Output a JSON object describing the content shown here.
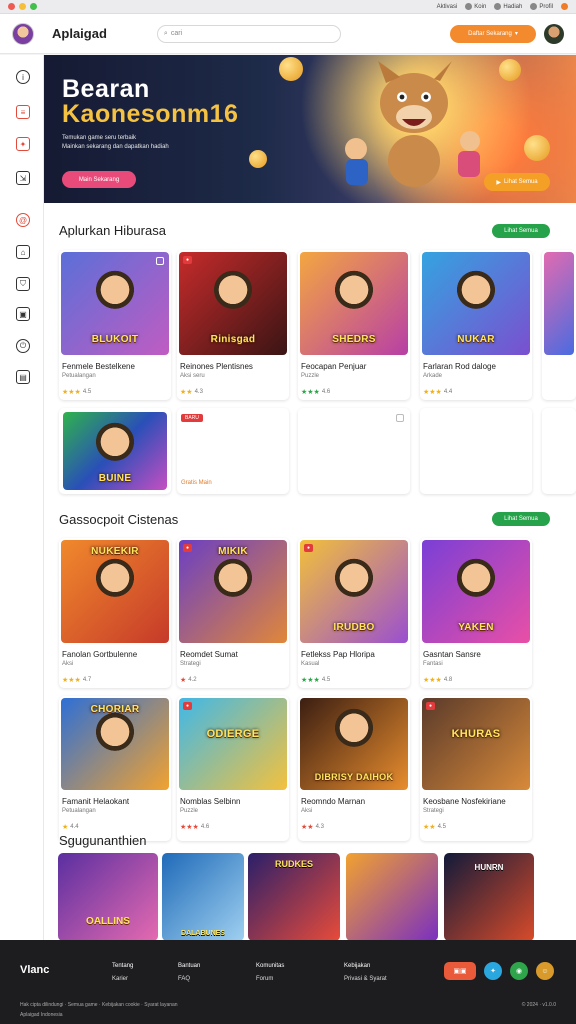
{
  "chrome": {
    "items": [
      "Aktivasi",
      "Koin",
      "Hadiah",
      "Profil"
    ]
  },
  "header": {
    "brand": "Aplaigad",
    "search_placeholder": "cari",
    "cta": "Daftar Sekarang"
  },
  "hero": {
    "title_line1": "Bearan",
    "title_line2": "Kaonesonm16",
    "subtitle_line1": "Temukan game seru terbaik",
    "subtitle_line2": "Mainkan sekarang dan dapatkan hadiah",
    "button_primary": "Main Sekarang",
    "button_secondary": "Lihat Semua"
  },
  "section1": {
    "title": "Aplurkan Hiburasa",
    "button": "Lihat Semua",
    "cards": [
      {
        "title": "Fenmele Bestelkene",
        "meta": "Petualangan",
        "rating": "4.5",
        "thumb_title": "BLUKOIT",
        "star": ""
      },
      {
        "title": "Reinones Plentisnes",
        "meta": "Aksi seru",
        "rating": "4.3",
        "thumb_title": "Rinisgad",
        "star": ""
      },
      {
        "title": "Feocapan Penjuar",
        "meta": "Puzzle",
        "rating": "4.6",
        "thumb_title": "SHEDRS",
        "star": "g"
      },
      {
        "title": "Farlaran Rod daloge",
        "meta": "Arkade",
        "rating": "4.4",
        "thumb_title": "NUKAR",
        "star": ""
      }
    ],
    "row2": {
      "thumb_title": "BUINE",
      "tag": "BARU",
      "text": "Gratis Main"
    }
  },
  "section2": {
    "title": "Gassocpoit Cistenas",
    "button": "Lihat Semua",
    "cards": [
      {
        "title": "Fanolan Gortbulenne",
        "meta": "Aksi",
        "rating": "4.7",
        "thumb_title": "NUKEKIR",
        "star": ""
      },
      {
        "title": "Reomdet Sumat",
        "meta": "Strategi",
        "rating": "4.2",
        "thumb_title": "MIKIK",
        "star": "r"
      },
      {
        "title": "Fetlekss Pap Hloripa",
        "meta": "Kasual",
        "rating": "4.5",
        "thumb_title": "IRUDBO",
        "star": "g"
      },
      {
        "title": "Gasntan Sansre",
        "meta": "Fantasi",
        "rating": "4.8",
        "thumb_title": "YAKEN",
        "star": ""
      },
      {
        "title": "Famanit Helaokant",
        "meta": "Petualangan",
        "rating": "4.4",
        "thumb_title": "CHORIAR",
        "star": ""
      },
      {
        "title": "Nomblas Selbinn",
        "meta": "Puzzle",
        "rating": "4.6",
        "thumb_title": "ODIERGE",
        "star": "r"
      },
      {
        "title": "Reomndo Marnan",
        "meta": "Aksi",
        "rating": "4.3",
        "thumb_title": "DIBRISY DAIHOK",
        "star": "r"
      },
      {
        "title": "Keosbane Nosfekiriane",
        "meta": "Strategi",
        "rating": "4.5",
        "thumb_title": "KHURAS",
        "star": ""
      }
    ]
  },
  "section3": {
    "title": "Sgugunanthien",
    "thumbs": [
      "OALLINS",
      "DALABUNES",
      "RUDKES",
      "",
      "HUNRN"
    ]
  },
  "footer": {
    "logo": "Vlanc",
    "cols": [
      {
        "h": "Tentang",
        "l": "Karier"
      },
      {
        "h": "Bantuan",
        "l": "FAQ"
      },
      {
        "h": "Komunitas",
        "l": "Forum"
      },
      {
        "h": "Kebijakan",
        "l": "Privasi & Syarat"
      }
    ],
    "bottom1": "Hak cipta dilindungi · Semua game · Kebijakan cookie · Syarat layanan",
    "bottom2": "Aplaigad Indonesia",
    "bottom_right": "© 2024 · v1.0.0"
  },
  "colors": {
    "accent_orange": "#f38a2d",
    "accent_green": "#26a34a",
    "accent_pink": "#e84b7a",
    "hero_gold": "#f6c242"
  }
}
